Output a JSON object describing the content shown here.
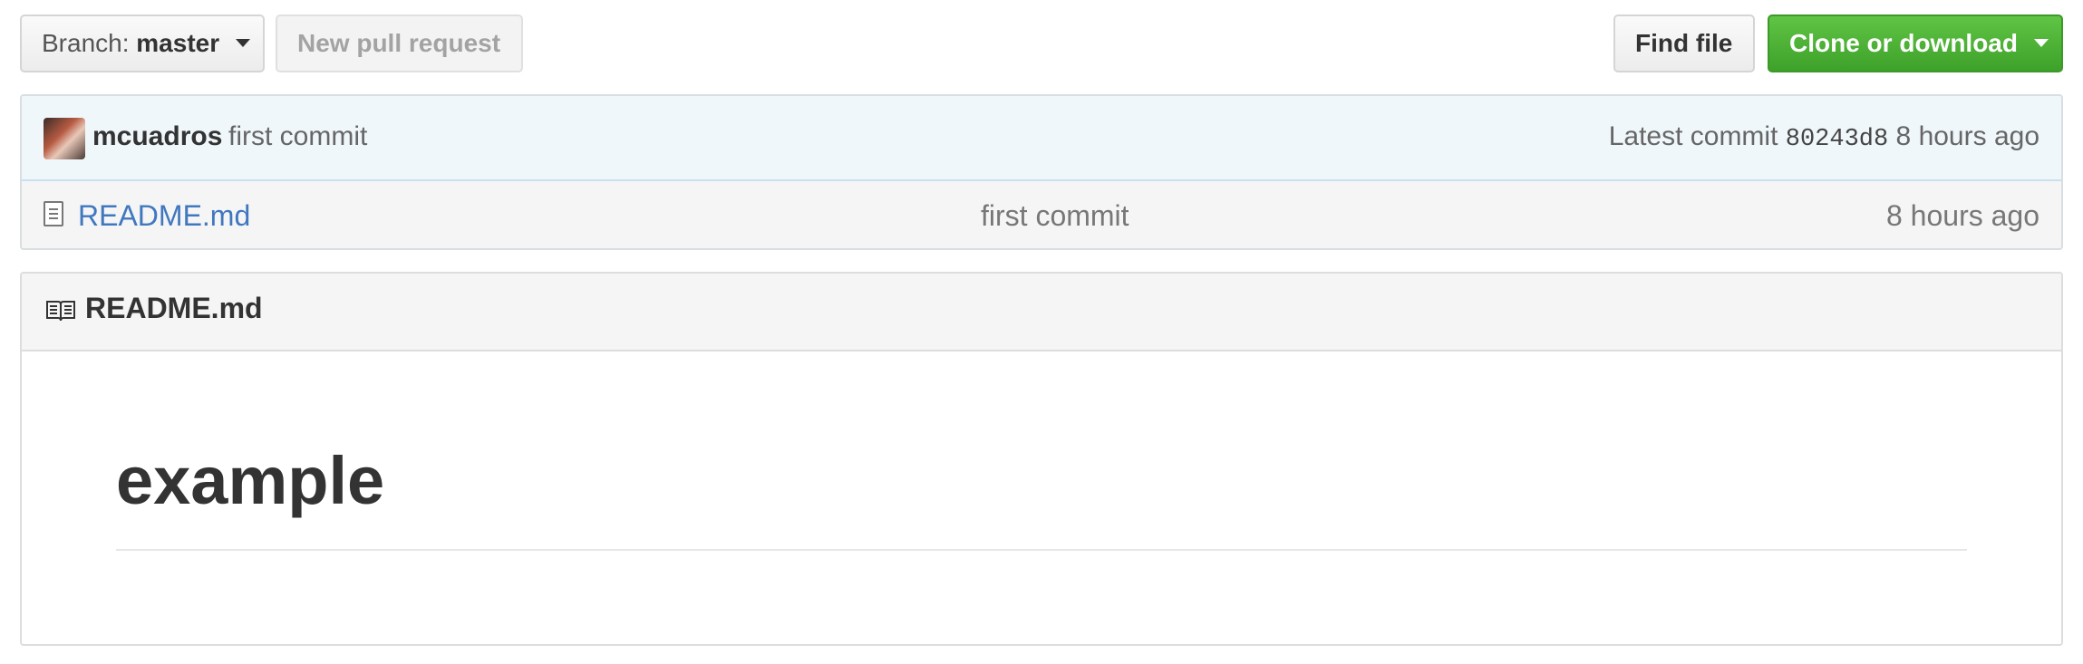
{
  "toolbar": {
    "branch_prefix": "Branch:",
    "branch_name": "master",
    "new_pull_request_label": "New pull request",
    "find_file_label": "Find file",
    "clone_label": "Clone or download"
  },
  "commit": {
    "author": "mcuadros",
    "message": "first commit",
    "latest_prefix": "Latest commit",
    "sha": "80243d8",
    "age": "8 hours ago"
  },
  "files": [
    {
      "name": "README.md",
      "message": "first commit",
      "age": "8 hours ago"
    }
  ],
  "readme": {
    "title": "README.md",
    "heading": "example"
  },
  "colors": {
    "accent_green": "#4cb135",
    "link_blue": "#4078c0",
    "commit_bg": "#eff7fb"
  },
  "icons": {
    "file": "file-icon",
    "readme": "book-icon",
    "caret": "caret-down-icon"
  }
}
